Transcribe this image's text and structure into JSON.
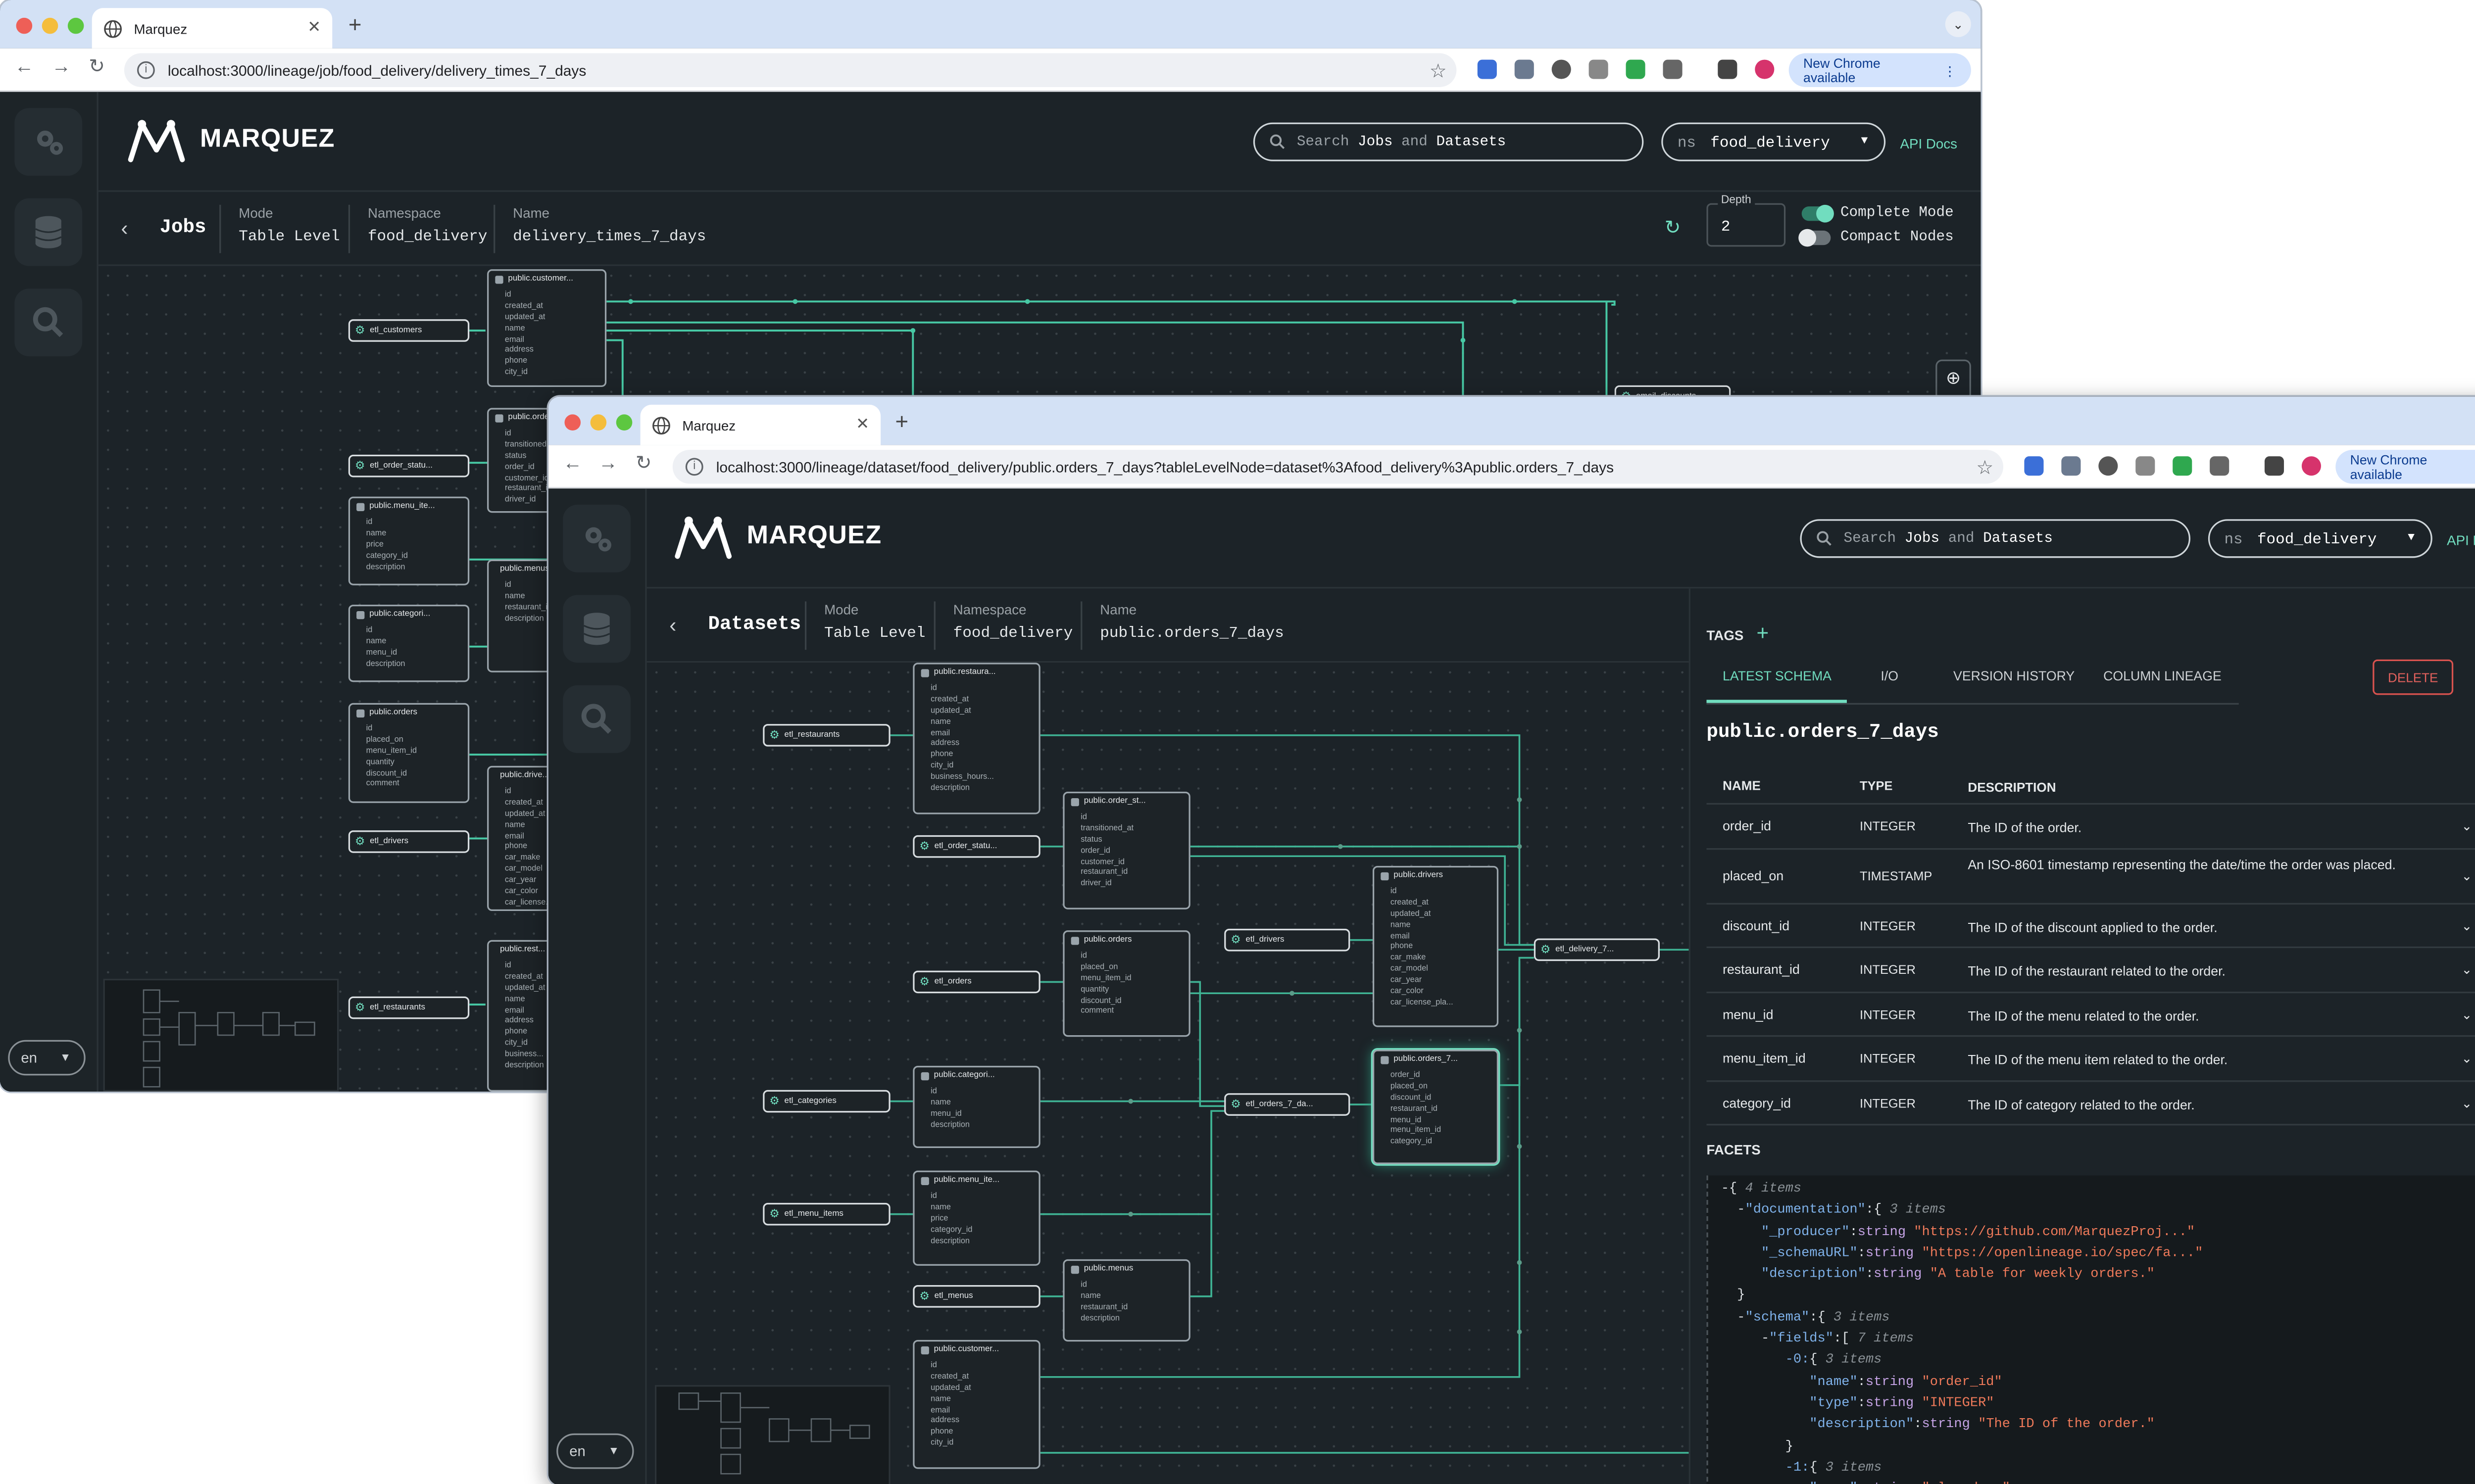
{
  "back_window": {
    "tab_title": "Marquez",
    "url": "localhost:3000/lineage/job/food_delivery/delivery_times_7_days",
    "chrome_update": "New Chrome available",
    "app": {
      "brand": "MARQUEZ",
      "search_prefix": "Search",
      "search_jobs": "Jobs",
      "search_and": "and",
      "search_datasets": "Datasets",
      "ns_prefix": "ns",
      "namespace_value": "food_delivery",
      "api_docs": "API Docs",
      "crumb_title": "Jobs",
      "mode_label": "Mode",
      "mode_value": "Table Level",
      "namespace_label": "Namespace",
      "namespace_crumb_value": "food_delivery",
      "name_label": "Name",
      "name_value": "delivery_times_7_days",
      "depth_label": "Depth",
      "depth_value": "2",
      "complete_mode": "Complete Mode",
      "compact_nodes": "Compact Nodes",
      "lang": "en"
    },
    "jobs": [
      "etl_customers",
      "etl_order_statu...",
      "etl_drivers",
      "etl_restaurants",
      "email_discounts"
    ],
    "datasets": [
      {
        "title": "public.customer...",
        "fields": [
          "id",
          "created_at",
          "updated_at",
          "name",
          "email",
          "address",
          "phone",
          "city_id"
        ]
      },
      {
        "title": "public.orders...",
        "fields": [
          "id",
          "transitioned...",
          "status",
          "order_id",
          "customer_id",
          "restaurant_id",
          "driver_id"
        ]
      },
      {
        "title": "public.menu_ite...",
        "fields": [
          "id",
          "name",
          "price",
          "category_id",
          "description"
        ]
      },
      {
        "title": "public.categori...",
        "fields": [
          "id",
          "name",
          "menu_id",
          "description"
        ]
      },
      {
        "title": "public.orders",
        "fields": [
          "id",
          "placed_on",
          "menu_item_id",
          "quantity",
          "discount_id",
          "comment"
        ]
      },
      {
        "title": "public.menus",
        "fields": [
          "id",
          "name",
          "restaurant_id",
          "description"
        ]
      },
      {
        "title": "public.drive...",
        "fields": [
          "id",
          "created_at",
          "updated_at",
          "name",
          "email",
          "phone",
          "car_make",
          "car_model",
          "car_year",
          "car_color",
          "car_license..."
        ]
      },
      {
        "title": "public.rest...",
        "fields": [
          "id",
          "created_at",
          "updated_at",
          "name",
          "email",
          "address",
          "phone",
          "city_id",
          "business...",
          "description"
        ]
      }
    ]
  },
  "front_window": {
    "tab_title": "Marquez",
    "url": "localhost:3000/lineage/dataset/food_delivery/public.orders_7_days?tableLevelNode=dataset%3Afood_delivery%3Apublic.orders_7_days",
    "chrome_update": "New Chrome available",
    "app": {
      "brand": "MARQUEZ",
      "search_prefix": "Search",
      "search_jobs": "Jobs",
      "search_and": "and",
      "search_datasets": "Datasets",
      "ns_prefix": "ns",
      "namespace_value": "food_delivery",
      "api_docs": "API Docs",
      "crumb_title": "Datasets",
      "mode_label": "Mode",
      "mode_value": "Table Level",
      "namespace_label": "Namespace",
      "namespace_crumb_value": "food_delivery",
      "name_label": "Name",
      "name_value": "public.orders_7_days",
      "lang": "en"
    },
    "jobs": [
      "etl_restaurants",
      "etl_order_statu...",
      "etl_orders",
      "etl_drivers",
      "etl_categories",
      "etl_orders_7_da...",
      "etl_menu_items",
      "etl_menus",
      "etl_delivery_7..."
    ],
    "datasets": [
      {
        "title": "public.restaura...",
        "fields": [
          "id",
          "created_at",
          "updated_at",
          "name",
          "email",
          "address",
          "phone",
          "city_id",
          "business_hours...",
          "description"
        ]
      },
      {
        "title": "public.order_st...",
        "fields": [
          "id",
          "transitioned_at",
          "status",
          "order_id",
          "customer_id",
          "restaurant_id",
          "driver_id"
        ]
      },
      {
        "title": "public.drivers",
        "fields": [
          "id",
          "created_at",
          "updated_at",
          "name",
          "email",
          "phone",
          "car_make",
          "car_model",
          "car_year",
          "car_color",
          "car_license_pla..."
        ]
      },
      {
        "title": "public.orders",
        "fields": [
          "id",
          "placed_on",
          "menu_item_id",
          "quantity",
          "discount_id",
          "comment"
        ]
      },
      {
        "title": "public.orders_7...",
        "fields": [
          "order_id",
          "placed_on",
          "discount_id",
          "restaurant_id",
          "menu_id",
          "menu_item_id",
          "category_id"
        ]
      },
      {
        "title": "public.categori...",
        "fields": [
          "id",
          "name",
          "menu_id",
          "description"
        ]
      },
      {
        "title": "public.menu_ite...",
        "fields": [
          "id",
          "name",
          "price",
          "category_id",
          "description"
        ]
      },
      {
        "title": "public.menus",
        "fields": [
          "id",
          "name",
          "restaurant_id",
          "description"
        ]
      },
      {
        "title": "public.customer...",
        "fields": [
          "id",
          "created_at",
          "updated_at",
          "name",
          "email",
          "address",
          "phone",
          "city_id"
        ]
      }
    ],
    "panel": {
      "tags_label": "TAGS",
      "tabs": [
        "LATEST SCHEMA",
        "I/O",
        "VERSION HISTORY",
        "COLUMN LINEAGE"
      ],
      "delete_label": "DELETE",
      "dataset_name": "public.orders_7_days",
      "columns": [
        "NAME",
        "TYPE",
        "DESCRIPTION"
      ],
      "rows": [
        {
          "name": "order_id",
          "type": "INTEGER",
          "description": "The ID of the order."
        },
        {
          "name": "placed_on",
          "type": "TIMESTAMP",
          "description": "An ISO-8601 timestamp representing the date/time the order was placed."
        },
        {
          "name": "discount_id",
          "type": "INTEGER",
          "description": "The ID of the discount applied to the order."
        },
        {
          "name": "restaurant_id",
          "type": "INTEGER",
          "description": "The ID of the restaurant related to the order."
        },
        {
          "name": "menu_id",
          "type": "INTEGER",
          "description": "The ID of the menu related to the order."
        },
        {
          "name": "menu_item_id",
          "type": "INTEGER",
          "description": "The ID of the menu item related to the order."
        },
        {
          "name": "category_id",
          "type": "INTEGER",
          "description": "The ID of category related to the order."
        }
      ],
      "facets_label": "FACETS",
      "json_lines": [
        "-{ 4 items",
        "  -\"documentation\":{ 3 items",
        "     \"_producer\":string \"https://github.com/MarquezProj...\"",
        "     \"_schemaURL\":string \"https://openlineage.io/spec/fa...\"",
        "     \"description\":string \"A table for weekly orders.\"",
        "  }",
        "  -\"schema\":{ 3 items",
        "     -\"fields\":[ 7 items",
        "        -0:{ 3 items",
        "           \"name\":string \"order_id\"",
        "           \"type\":string \"INTEGER\"",
        "           \"description\":string \"The ID of the order.\"",
        "        }",
        "        -1:{ 3 items",
        "           \"name\":string \"placed_on\""
      ]
    }
  },
  "colors": {
    "accent": "#71ddbf",
    "background": "#1c2328",
    "delete": "#e3615d"
  }
}
